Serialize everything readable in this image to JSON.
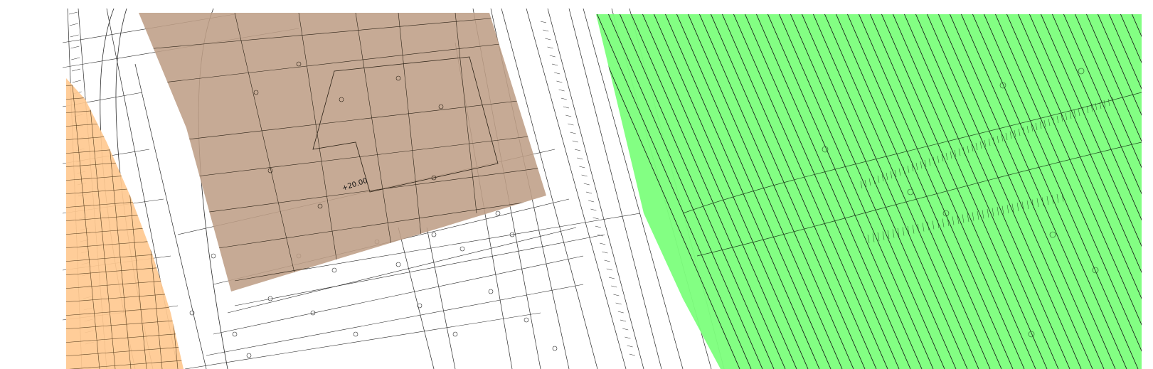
{
  "map": {
    "elevation_label": "+20.00",
    "zones": {
      "orange": {
        "color": "#FFC990"
      },
      "brown": {
        "color": "#BE9E86"
      },
      "green": {
        "color": "#7CFF7C",
        "hatch": "#111111"
      }
    },
    "linework_color": "#2a2a2a"
  }
}
